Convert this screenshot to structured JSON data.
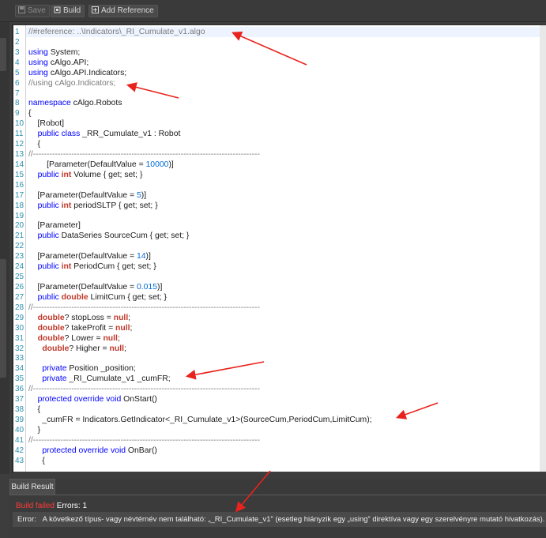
{
  "toolbar": {
    "save_label": "Save",
    "build_label": "Build",
    "add_reference_label": "Add Reference"
  },
  "editor": {
    "lines": [
      {
        "n": "1",
        "segs": [
          {
            "t": "//#reference: ..\\Indicators\\_RI_Cumulate_v1.algo",
            "c": "cm"
          }
        ]
      },
      {
        "n": "2",
        "segs": []
      },
      {
        "n": "3",
        "segs": [
          {
            "t": "using",
            "c": "kw"
          },
          {
            "t": " System;",
            "c": ""
          }
        ]
      },
      {
        "n": "4",
        "segs": [
          {
            "t": "using",
            "c": "kw"
          },
          {
            "t": " cAlgo.API;",
            "c": ""
          }
        ]
      },
      {
        "n": "5",
        "segs": [
          {
            "t": "using",
            "c": "kw"
          },
          {
            "t": " cAlgo.API.Indicators;",
            "c": ""
          }
        ]
      },
      {
        "n": "6",
        "segs": [
          {
            "t": "//using cAlgo.Indicators;",
            "c": "cm"
          }
        ]
      },
      {
        "n": "7",
        "segs": []
      },
      {
        "n": "8",
        "segs": [
          {
            "t": "namespace",
            "c": "kw"
          },
          {
            "t": " cAlgo.Robots",
            "c": ""
          }
        ]
      },
      {
        "n": "9",
        "segs": [
          {
            "t": "{",
            "c": ""
          }
        ]
      },
      {
        "n": "10",
        "segs": [
          {
            "t": "    [Robot]",
            "c": ""
          }
        ]
      },
      {
        "n": "11",
        "segs": [
          {
            "t": "    ",
            "c": ""
          },
          {
            "t": "public",
            "c": "kw"
          },
          {
            "t": " ",
            "c": ""
          },
          {
            "t": "class",
            "c": "kw"
          },
          {
            "t": " _RR_Cumulate_v1 : Robot",
            "c": ""
          }
        ]
      },
      {
        "n": "12",
        "segs": [
          {
            "t": "    {",
            "c": ""
          }
        ]
      },
      {
        "n": "13",
        "segs": [
          {
            "t": "//-----------------------------------------------------------------------------------",
            "c": "cm"
          }
        ]
      },
      {
        "n": "14",
        "segs": [
          {
            "t": "        [Parameter(DefaultValue = ",
            "c": ""
          },
          {
            "t": "10000",
            "c": "nm"
          },
          {
            "t": ")]",
            "c": ""
          }
        ]
      },
      {
        "n": "15",
        "segs": [
          {
            "t": "    ",
            "c": ""
          },
          {
            "t": "public",
            "c": "kw"
          },
          {
            "t": " ",
            "c": ""
          },
          {
            "t": "int",
            "c": "kb"
          },
          {
            "t": " Volume { get; set; }",
            "c": ""
          }
        ]
      },
      {
        "n": "16",
        "segs": []
      },
      {
        "n": "17",
        "segs": [
          {
            "t": "    [Parameter(DefaultValue = ",
            "c": ""
          },
          {
            "t": "5",
            "c": "nm"
          },
          {
            "t": ")]",
            "c": ""
          }
        ]
      },
      {
        "n": "18",
        "segs": [
          {
            "t": "    ",
            "c": ""
          },
          {
            "t": "public",
            "c": "kw"
          },
          {
            "t": " ",
            "c": ""
          },
          {
            "t": "int",
            "c": "kb"
          },
          {
            "t": " periodSLTP { get; set; }",
            "c": ""
          }
        ]
      },
      {
        "n": "19",
        "segs": []
      },
      {
        "n": "20",
        "segs": [
          {
            "t": "    [Parameter]",
            "c": ""
          }
        ]
      },
      {
        "n": "21",
        "segs": [
          {
            "t": "    ",
            "c": ""
          },
          {
            "t": "public",
            "c": "kw"
          },
          {
            "t": " DataSeries SourceCum { get; set; }",
            "c": ""
          }
        ]
      },
      {
        "n": "22",
        "segs": []
      },
      {
        "n": "23",
        "segs": [
          {
            "t": "    [Parameter(DefaultValue = ",
            "c": ""
          },
          {
            "t": "14",
            "c": "nm"
          },
          {
            "t": ")]",
            "c": ""
          }
        ]
      },
      {
        "n": "24",
        "segs": [
          {
            "t": "    ",
            "c": ""
          },
          {
            "t": "public",
            "c": "kw"
          },
          {
            "t": " ",
            "c": ""
          },
          {
            "t": "int",
            "c": "kb"
          },
          {
            "t": " PeriodCum { get; set; }",
            "c": ""
          }
        ]
      },
      {
        "n": "25",
        "segs": []
      },
      {
        "n": "26",
        "segs": [
          {
            "t": "    [Parameter(DefaultValue = ",
            "c": ""
          },
          {
            "t": "0.015",
            "c": "nm"
          },
          {
            "t": ")]",
            "c": ""
          }
        ]
      },
      {
        "n": "27",
        "segs": [
          {
            "t": "    ",
            "c": ""
          },
          {
            "t": "public",
            "c": "kw"
          },
          {
            "t": " ",
            "c": ""
          },
          {
            "t": "double",
            "c": "kb"
          },
          {
            "t": " LimitCum { get; set; }",
            "c": ""
          }
        ]
      },
      {
        "n": "28",
        "segs": [
          {
            "t": "//-----------------------------------------------------------------------------------",
            "c": "cm"
          }
        ]
      },
      {
        "n": "29",
        "segs": [
          {
            "t": "    ",
            "c": ""
          },
          {
            "t": "double",
            "c": "kb"
          },
          {
            "t": "? stopLoss = ",
            "c": ""
          },
          {
            "t": "null",
            "c": "kb"
          },
          {
            "t": ";",
            "c": ""
          }
        ]
      },
      {
        "n": "30",
        "segs": [
          {
            "t": "    ",
            "c": ""
          },
          {
            "t": "double",
            "c": "kb"
          },
          {
            "t": "? takeProfit = ",
            "c": ""
          },
          {
            "t": "null",
            "c": "kb"
          },
          {
            "t": ";",
            "c": ""
          }
        ]
      },
      {
        "n": "31",
        "segs": [
          {
            "t": "    ",
            "c": ""
          },
          {
            "t": "double",
            "c": "kb"
          },
          {
            "t": "? Lower = ",
            "c": ""
          },
          {
            "t": "null",
            "c": "kb"
          },
          {
            "t": ";",
            "c": ""
          }
        ]
      },
      {
        "n": "32",
        "segs": [
          {
            "t": "      ",
            "c": ""
          },
          {
            "t": "double",
            "c": "kb"
          },
          {
            "t": "? Higher = ",
            "c": ""
          },
          {
            "t": "null",
            "c": "kb"
          },
          {
            "t": ";",
            "c": ""
          }
        ]
      },
      {
        "n": "33",
        "segs": []
      },
      {
        "n": "34",
        "segs": [
          {
            "t": "      ",
            "c": ""
          },
          {
            "t": "private",
            "c": "kw"
          },
          {
            "t": " Position _position;",
            "c": ""
          }
        ]
      },
      {
        "n": "35",
        "segs": [
          {
            "t": "      ",
            "c": ""
          },
          {
            "t": "private",
            "c": "kw"
          },
          {
            "t": " _RI_Cumulate_v1 _cumFR;",
            "c": ""
          }
        ]
      },
      {
        "n": "36",
        "segs": [
          {
            "t": "//-----------------------------------------------------------------------------------",
            "c": "cm"
          }
        ]
      },
      {
        "n": "37",
        "segs": [
          {
            "t": "    ",
            "c": ""
          },
          {
            "t": "protected",
            "c": "kw"
          },
          {
            "t": " ",
            "c": ""
          },
          {
            "t": "override",
            "c": "kw"
          },
          {
            "t": " ",
            "c": ""
          },
          {
            "t": "void",
            "c": "kw"
          },
          {
            "t": " OnStart()",
            "c": ""
          }
        ]
      },
      {
        "n": "38",
        "segs": [
          {
            "t": "    {",
            "c": ""
          }
        ]
      },
      {
        "n": "39",
        "segs": [
          {
            "t": "      _cumFR = Indicators.GetIndicator<_RI_Cumulate_v1>(SourceCum,PeriodCum,LimitCum);",
            "c": ""
          }
        ]
      },
      {
        "n": "40",
        "segs": [
          {
            "t": "    }",
            "c": ""
          }
        ]
      },
      {
        "n": "41",
        "segs": [
          {
            "t": "//-----------------------------------------------------------------------------------",
            "c": "cm"
          }
        ]
      },
      {
        "n": "42",
        "segs": [
          {
            "t": "      ",
            "c": ""
          },
          {
            "t": "protected",
            "c": "kw"
          },
          {
            "t": " ",
            "c": ""
          },
          {
            "t": "override",
            "c": "kw"
          },
          {
            "t": " ",
            "c": ""
          },
          {
            "t": "void",
            "c": "kw"
          },
          {
            "t": " OnBar()",
            "c": ""
          }
        ]
      },
      {
        "n": "43",
        "segs": [
          {
            "t": "      {",
            "c": ""
          }
        ]
      }
    ]
  },
  "build_result": {
    "tab_label": "Build Result",
    "status_failed": "Build failed",
    "status_errors": " Errors: 1",
    "error_label": "Error:",
    "error_message": "A következő típus- vagy névtérnév nem található: „_RI_Cumulate_v1” (esetleg hiányzik egy „using” direktíva vagy egy szerelvényre mutató hivatkozás)."
  },
  "colors": {
    "annotation_arrow": "#e8221c",
    "error_text": "#ff3b3b",
    "line_number": "#2b91af"
  }
}
